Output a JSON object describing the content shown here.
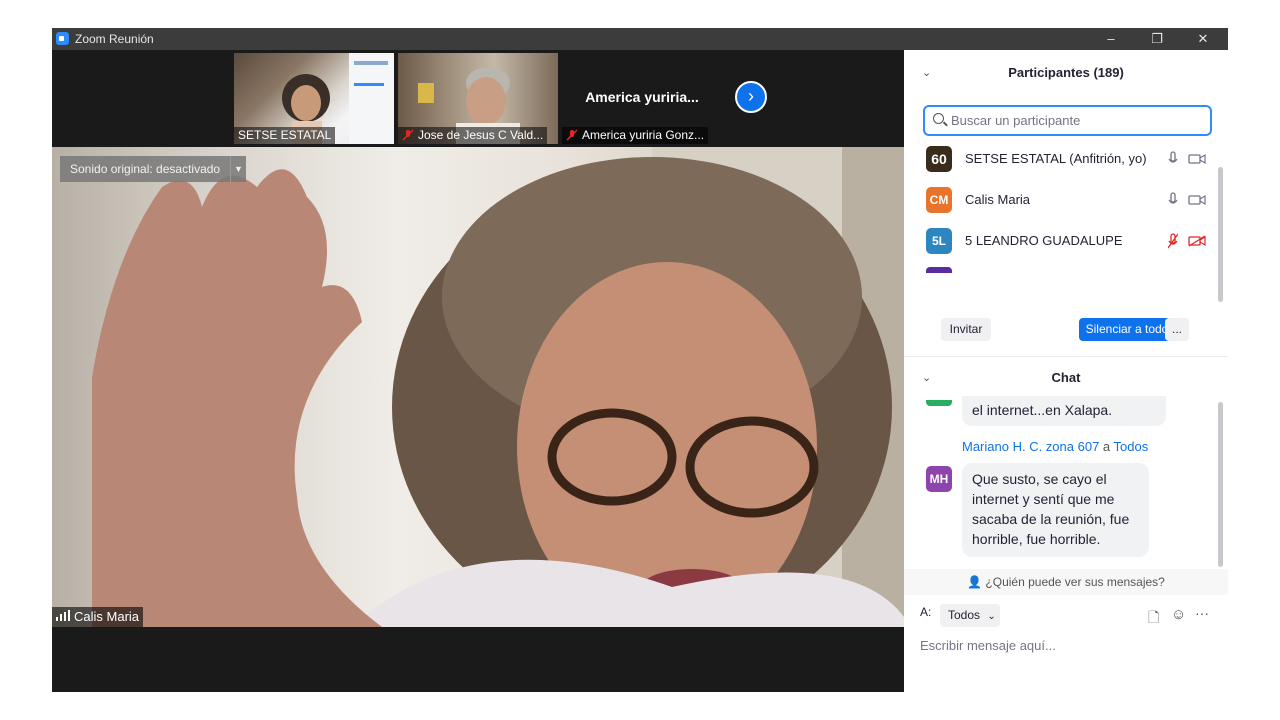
{
  "window": {
    "title": "Zoom Reunión",
    "minimize": "–",
    "restore": "❐",
    "close": "✕"
  },
  "strip": {
    "thumbs": [
      {
        "name": "SETSE ESTATAL",
        "muted": false
      },
      {
        "name": "Jose de Jesus C Vald...",
        "muted": true
      },
      {
        "name": "America yuriria Gonz...",
        "muted": true,
        "display_name": "America  yuriria..."
      }
    ],
    "next_icon": "chevron-right-icon"
  },
  "main_video": {
    "sound_label": "Sonido original: desactivado",
    "speaker": "Calis Maria"
  },
  "participants": {
    "header": "Participantes (189)",
    "search_placeholder": "Buscar un participante",
    "list": [
      {
        "initials": "60",
        "name": "SETSE ESTATAL (Anfitrión, yo)",
        "color": "#3a2c1c",
        "muted": false
      },
      {
        "initials": "CM",
        "name": "Calis Maria",
        "color": "#e8732a",
        "muted": false
      },
      {
        "initials": "5L",
        "name": "5 LEANDRO GUADALUPE",
        "color": "#2e86c1",
        "muted": true
      }
    ],
    "invite_label": "Invitar",
    "mute_all_label": "Silenciar a todos",
    "more_label": "..."
  },
  "chat": {
    "header": "Chat",
    "prev_message_tail": "el internet...en Xalapa.",
    "message": {
      "sender": "Mariano H. C. zona 607",
      "to_word": "a",
      "to": "Todos",
      "initials": "MH",
      "avatar_color": "#8e44ad",
      "lines": [
        "Que susto, se cayo el",
        "internet y sentí que me",
        "sacaba de la reunión, fue",
        "horrible, fue horrible."
      ]
    },
    "who_sees": "¿Quién puede ver sus mensajes?",
    "to_label": "A:",
    "to_value": "Todos",
    "compose_placeholder": "Escribir mensaje aquí..."
  },
  "colors": {
    "accent": "#0e72ed",
    "mute_red": "#e02828"
  }
}
